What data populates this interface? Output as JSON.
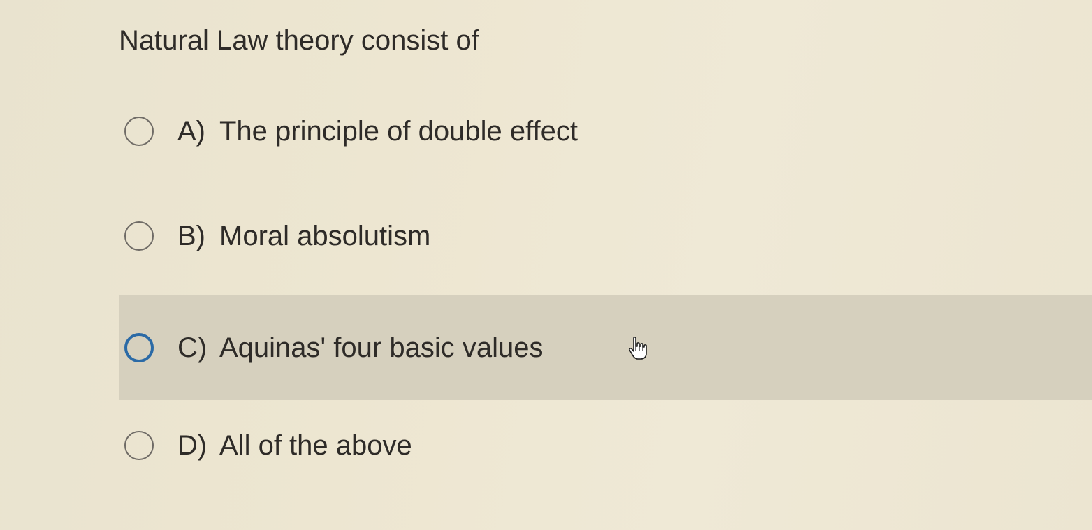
{
  "question": {
    "text": "Natural Law theory consist of"
  },
  "options": [
    {
      "letter": "A)",
      "label": "The principle of double effect",
      "selected": false,
      "hovered": false
    },
    {
      "letter": "B)",
      "label": "Moral absolutism",
      "selected": false,
      "hovered": false
    },
    {
      "letter": "C)",
      "label": "Aquinas' four basic values",
      "selected": false,
      "hovered": true
    },
    {
      "letter": "D)",
      "label": "All of the above",
      "selected": false,
      "hovered": false
    }
  ],
  "colors": {
    "hover_background": "#d6d0be",
    "radio_focus": "#2b6aa6",
    "radio_default": "#6f6b66"
  },
  "cursor": {
    "icon": "hand-pointer-icon"
  }
}
